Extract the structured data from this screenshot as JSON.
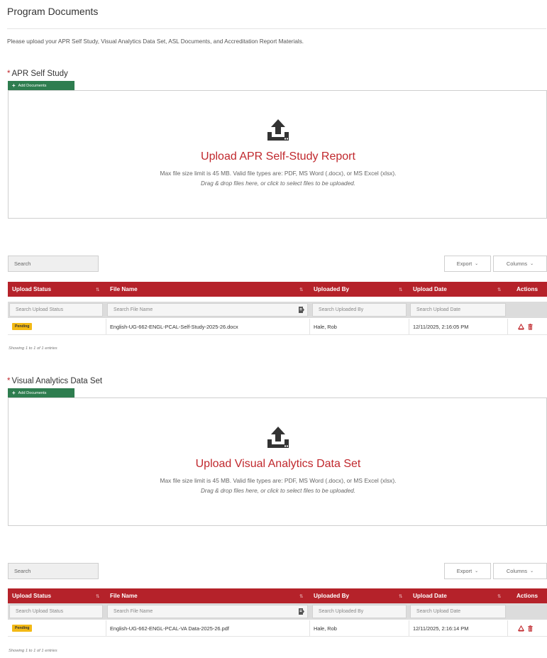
{
  "page": {
    "title": "Program Documents",
    "intro": "Please upload your APR Self Study, Visual Analytics Data Set, ASL Documents, and Accreditation Report Materials."
  },
  "sections": [
    {
      "required_mark": "*",
      "title": "APR Self Study",
      "add_button_label": "Add Documents",
      "dropzone": {
        "title": "Upload APR Self-Study Report",
        "limit": "Max file size limit is 45 MB. Valid file types are: PDF, MS Word (.docx), or MS Excel (xlsx).",
        "hint": "Drag & drop files here, or click to select files to be uploaded."
      },
      "search_placeholder": "Search",
      "export_label": "Export",
      "columns_label": "Columns",
      "headers": [
        "Upload Status",
        "File Name",
        "Uploaded By",
        "Upload Date",
        "Actions"
      ],
      "filters": [
        "Search Upload Status",
        "Search File Name",
        "Search Uploaded By",
        "Search Upload Date"
      ],
      "rows": [
        {
          "status": "Pending",
          "file_name": "English-UG-662-ENGL-PCAL-Self-Study-2025-26.docx",
          "uploaded_by": "Hale, Rob",
          "upload_date": "12/11/2025, 2:16:05 PM"
        }
      ],
      "showing": "Showing 1 to 1 of 1 entries"
    },
    {
      "required_mark": "*",
      "title": "Visual Analytics Data Set",
      "add_button_label": "Add Documents",
      "dropzone": {
        "title": "Upload Visual Analytics Data Set",
        "limit": "Max file size limit is 45 MB. Valid file types are: PDF, MS Word (.docx), or MS Excel (xlsx).",
        "hint": "Drag & drop files here, or click to select files to be uploaded."
      },
      "search_placeholder": "Search",
      "export_label": "Export",
      "columns_label": "Columns",
      "headers": [
        "Upload Status",
        "File Name",
        "Uploaded By",
        "Upload Date",
        "Actions"
      ],
      "filters": [
        "Search Upload Status",
        "Search File Name",
        "Search Uploaded By",
        "Search Upload Date"
      ],
      "rows": [
        {
          "status": "Pending",
          "file_name": "English-UG-662-ENGL-PCAL-VA Data-2025-26.pdf",
          "uploaded_by": "Hale, Rob",
          "upload_date": "12/11/2025, 2:16:14 PM"
        }
      ],
      "showing": "Showing 1 to 1 of 1 entries"
    }
  ],
  "colors": {
    "accent_red": "#b5222a",
    "title_red": "#c0282d",
    "button_green": "#2e7d4f",
    "pending_yellow": "#f3b915"
  },
  "icons": [
    "plus-icon",
    "upload-icon",
    "sort-icon",
    "filter-icon",
    "pdf-icon",
    "trash-icon",
    "chevron-down-icon"
  ]
}
